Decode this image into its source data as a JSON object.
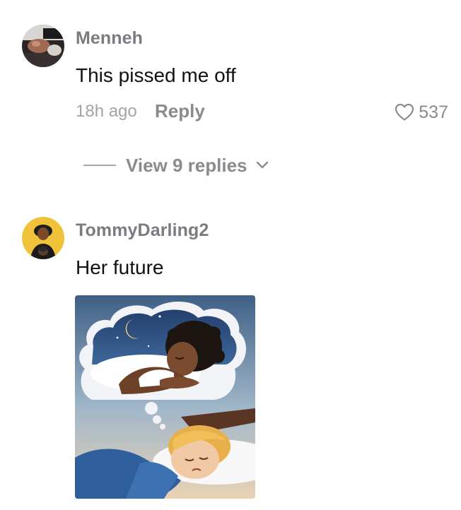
{
  "comments": [
    {
      "username": "Menneh",
      "text": "This pissed me off",
      "timestamp": "18h ago",
      "reply_label": "Reply",
      "like_count": "537",
      "view_replies_label": "View 9 replies",
      "icons": [
        "avatar",
        "heart-outline-icon",
        "chevron-down-icon"
      ]
    },
    {
      "username": "TommyDarling2",
      "text": "Her future",
      "image_description_icons": [
        "comment-image"
      ]
    }
  ],
  "colors": {
    "username": "#7b7b80",
    "text": "#111111",
    "muted": "#a3a3a8",
    "action": "#8a8a8f"
  }
}
